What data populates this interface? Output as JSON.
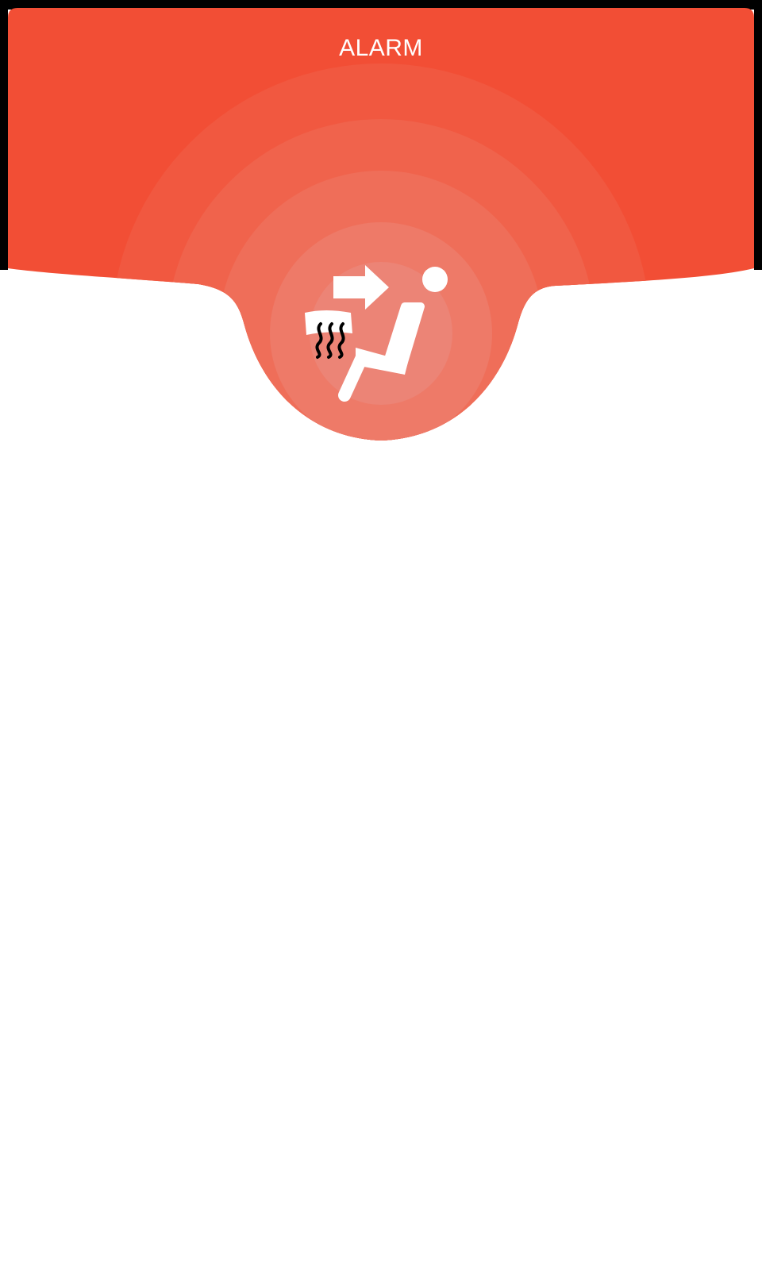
{
  "header": {
    "title": "ALARM",
    "accent_color": "#F24E35"
  },
  "alarm": {
    "icon": "seat-heater-occupant-icon",
    "badge_color": "#EC8476"
  }
}
